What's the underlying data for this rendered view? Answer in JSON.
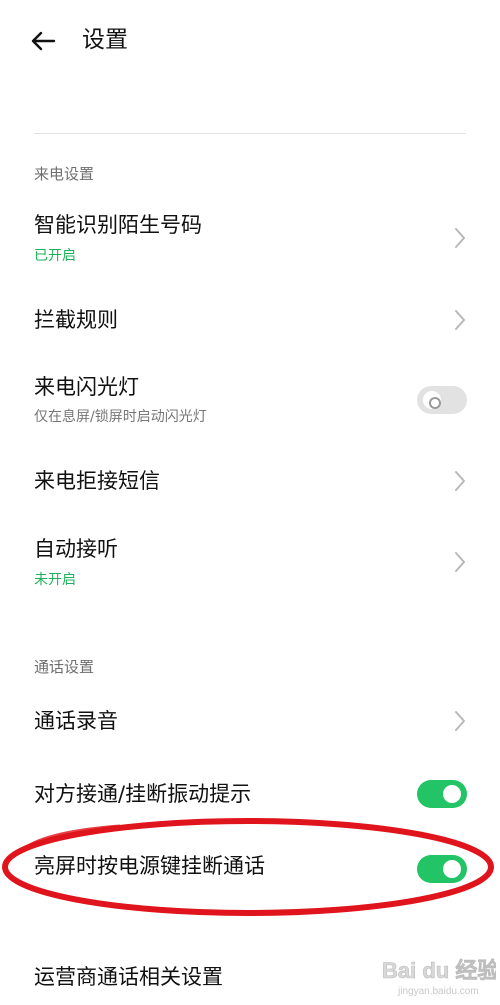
{
  "header": {
    "title": "设置",
    "back_icon": "arrow-left-icon"
  },
  "sections": {
    "incoming": {
      "label": "来电设置"
    },
    "call": {
      "label": "通话设置"
    }
  },
  "items": {
    "smart_identify": {
      "title": "智能识别陌生号码",
      "subtitle": "已开启",
      "control": "chevron-right-icon"
    },
    "block_rules": {
      "title": "拦截规则",
      "control": "chevron-right-icon"
    },
    "flash_light": {
      "title": "来电闪光灯",
      "subtitle": "仅在息屏/锁屏时启动闪光灯",
      "toggle": "off"
    },
    "reject_sms": {
      "title": "来电拒接短信",
      "control": "chevron-right-icon"
    },
    "auto_answer": {
      "title": "自动接听",
      "subtitle": "未开启",
      "control": "chevron-right-icon"
    },
    "call_recording": {
      "title": "通话录音",
      "control": "chevron-right-icon"
    },
    "vibrate_hint": {
      "title": "对方接通/挂断振动提示",
      "toggle": "on"
    },
    "power_hangup": {
      "title": "亮屏时按电源键挂断通话",
      "toggle": "on"
    },
    "carrier_settings": {
      "title": "运营商通话相关设置"
    }
  },
  "colors": {
    "accent_green": "#22c465",
    "subtitle_green": "#1fb15a",
    "annotation_red": "#e0141c"
  },
  "watermark": {
    "text": "Bai du 经验",
    "url": "jingyan.baidu.com"
  }
}
